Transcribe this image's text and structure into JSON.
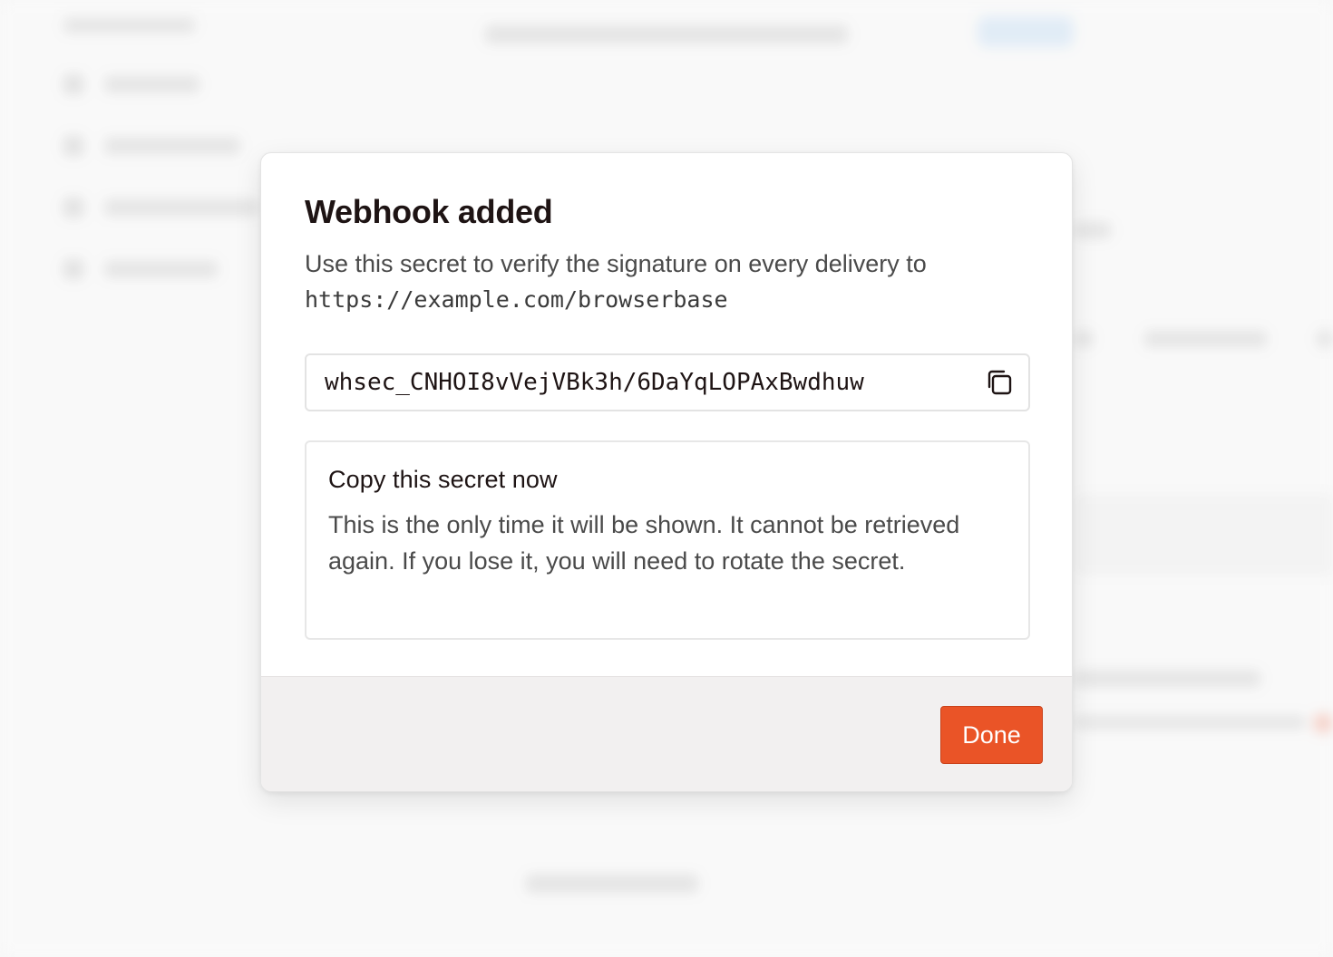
{
  "dialog": {
    "title": "Webhook added",
    "description": "Use this secret to verify the signature on every delivery to",
    "url": "https://example.com/browserbase",
    "secret": "whsec_CNHOI8vVejVBk3h/6DaYqLOPAxBwdhuw",
    "copy_icon": "copy-icon",
    "warning": {
      "title": "Copy this secret now",
      "text": "This is the only time it will be shown. It cannot be retrieved again. If you lose it, you will need to rotate the secret."
    },
    "done_label": "Done"
  },
  "colors": {
    "accent": "#ea5427",
    "title": "#1e1414",
    "body_text": "#4a4a4a",
    "footer_bg": "#f2f0f0"
  }
}
